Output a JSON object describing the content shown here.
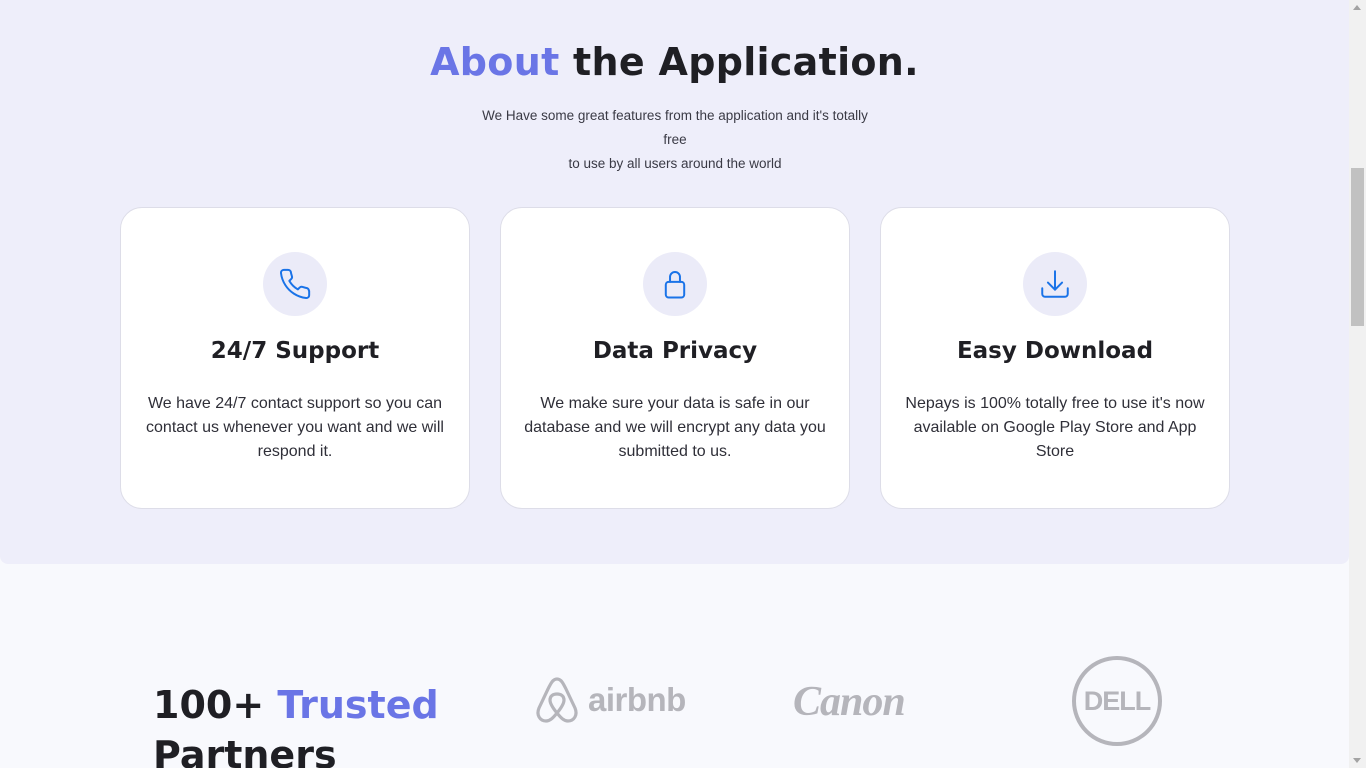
{
  "about": {
    "title_accent": "About",
    "title_rest": " the Application.",
    "subtitle_line1": "We Have some great features from the application and it's totally free",
    "subtitle_line2": "to use by all users around the world"
  },
  "features": [
    {
      "icon": "phone-icon",
      "title": "24/7 Support",
      "text": "We have 24/7 contact support so you can contact us whenever you want and we will respond it."
    },
    {
      "icon": "lock-icon",
      "title": "Data Privacy",
      "text": "We make sure your data is safe in our database and we will encrypt any data you submitted to us."
    },
    {
      "icon": "download-icon",
      "title": "Easy Download",
      "text": "Nepays is 100% totally free to use it's now available on Google Play Store and App Store"
    }
  ],
  "partners": {
    "title_prefix": "100+ ",
    "title_accent": "Trusted",
    "title_suffix": "Partners",
    "logos": [
      "airbnb",
      "Canon",
      "DELL"
    ]
  },
  "colors": {
    "accent": "#6a75e6",
    "icon_blue": "#1a73e8",
    "section_bg": "#eeeefa",
    "logo_gray": "#b5b5bb"
  }
}
